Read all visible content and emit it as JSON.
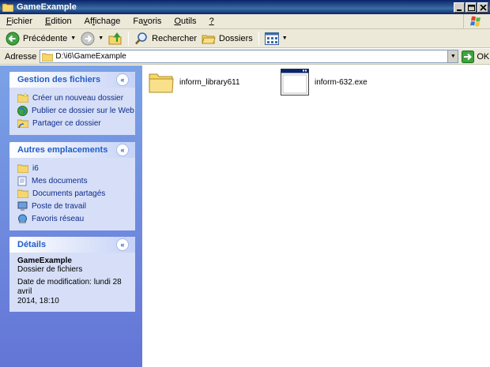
{
  "window": {
    "title": "GameExample"
  },
  "menu": {
    "items": [
      {
        "pre": "",
        "key": "F",
        "post": "ichier"
      },
      {
        "pre": "",
        "key": "E",
        "post": "dition"
      },
      {
        "pre": "Af",
        "key": "f",
        "post": "ichage"
      },
      {
        "pre": "Fa",
        "key": "v",
        "post": "oris"
      },
      {
        "pre": "",
        "key": "O",
        "post": "utils"
      },
      {
        "pre": "",
        "key": "?",
        "post": ""
      }
    ]
  },
  "toolbar": {
    "back_label": "Précédente",
    "search_label": "Rechercher",
    "folders_label": "Dossiers"
  },
  "address": {
    "label": "Adresse",
    "path": "D:\\i6\\GameExample",
    "go_label": "OK"
  },
  "panels": {
    "tasks": {
      "title": "Gestion des fichiers",
      "links": [
        {
          "label": "Créer un nouveau dossier",
          "icon": "new-folder-icon"
        },
        {
          "label": "Publier ce dossier sur le Web",
          "icon": "globe-icon"
        },
        {
          "label": "Partager ce dossier",
          "icon": "share-folder-icon"
        }
      ]
    },
    "places": {
      "title": "Autres emplacements",
      "links": [
        {
          "label": "i6",
          "icon": "folder-icon"
        },
        {
          "label": "Mes documents",
          "icon": "documents-icon"
        },
        {
          "label": "Documents partagés",
          "icon": "shared-folder-icon"
        },
        {
          "label": "Poste de travail",
          "icon": "computer-icon"
        },
        {
          "label": "Favoris réseau",
          "icon": "network-icon"
        }
      ]
    },
    "details": {
      "title": "Détails",
      "name": "GameExample",
      "type": "Dossier de fichiers",
      "modified_line1": "Date de modification: lundi 28 avril",
      "modified_line2": "2014, 18:10"
    }
  },
  "files": [
    {
      "name": "inform_library611",
      "icon": "folder-icon"
    },
    {
      "name": "inform-632.exe",
      "icon": "exe-window-icon"
    }
  ],
  "colors": {
    "titlebar": "#0a246a",
    "panel_title": "#215dc6",
    "left_pane": "#7ba2e7",
    "folder": "#f5d76e"
  }
}
